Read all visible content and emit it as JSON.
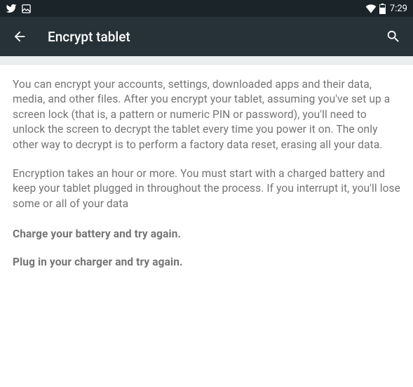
{
  "statusBar": {
    "time": "7:29"
  },
  "appBar": {
    "title": "Encrypt tablet"
  },
  "content": {
    "paragraph1": "You can encrypt your accounts, settings, downloaded apps and their data, media, and other files. After you encrypt your tablet, assuming you've set up a screen lock (that is, a pattern or numeric PIN or password), you'll need to unlock the screen to decrypt the tablet every time you power it on. The only other way to decrypt is to perform a factory data reset, erasing all your data.",
    "paragraph2": "Encryption takes an hour or more. You must start with a charged battery and keep your tablet plugged in throughout the process. If you interrupt it, you'll lose some or all of your data",
    "warning1": "Charge your battery and try again.",
    "warning2": "Plug in your charger and try again."
  }
}
